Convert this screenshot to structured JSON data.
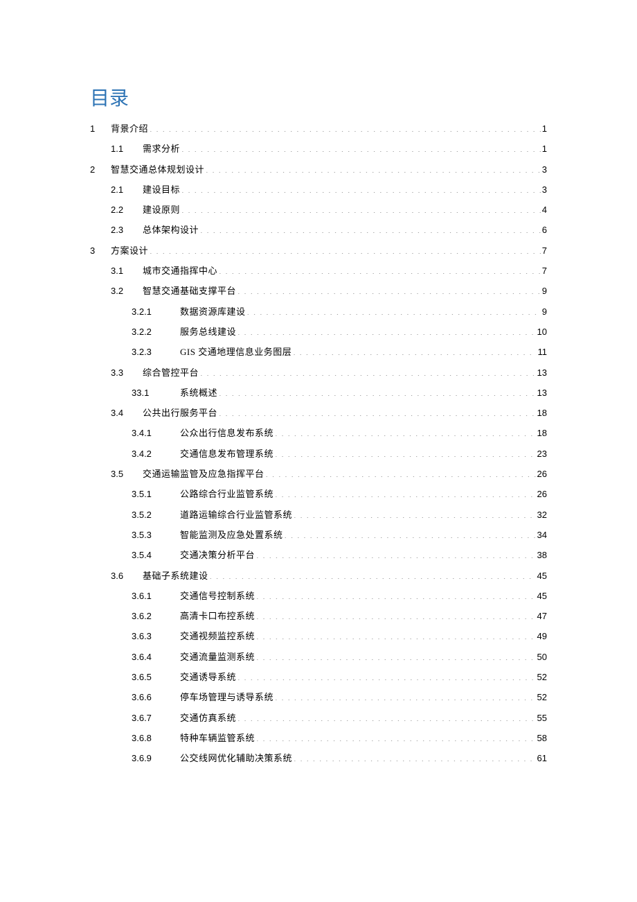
{
  "title": "目录",
  "toc": [
    {
      "level": 1,
      "num": "1",
      "label": "背景介绍",
      "page": "1"
    },
    {
      "level": 2,
      "num": "1.1",
      "label": "需求分析",
      "page": "1"
    },
    {
      "level": 1,
      "num": "2",
      "label": "智慧交通总体规划设计",
      "page": "3"
    },
    {
      "level": 2,
      "num": "2.1",
      "label": "建设目标",
      "page": "3"
    },
    {
      "level": 2,
      "num": "2.2",
      "label": "建设原则",
      "page": "4"
    },
    {
      "level": 2,
      "num": "2.3",
      "label": "总体架构设计",
      "page": "6"
    },
    {
      "level": 1,
      "num": "3",
      "label": "方案设计",
      "page": "7"
    },
    {
      "level": 2,
      "num": "3.1",
      "label": "城市交通指挥中心",
      "page": "7"
    },
    {
      "level": 2,
      "num": "3.2",
      "label": "智慧交通基础支撑平台",
      "page": "9"
    },
    {
      "level": 3,
      "num": "3.2.1",
      "label": "数据资源库建设",
      "page": "9"
    },
    {
      "level": 3,
      "num": "3.2.2",
      "label": "服务总线建设",
      "page": "10"
    },
    {
      "level": 3,
      "num": "3.2.3",
      "label": "GIS 交通地理信息业务图层",
      "page": "11"
    },
    {
      "level": 2,
      "num": "3.3",
      "label": "综合管控平台",
      "page": "13"
    },
    {
      "level": 3,
      "num": "33.1",
      "label": "系统概述",
      "page": "13"
    },
    {
      "level": 2,
      "num": "3.4",
      "label": "公共出行服务平台",
      "page": "18"
    },
    {
      "level": 3,
      "num": "3.4.1",
      "label": "公众出行信息发布系统",
      "page": "18"
    },
    {
      "level": 3,
      "num": "3.4.2",
      "label": "交通信息发布管理系统",
      "page": "23"
    },
    {
      "level": 2,
      "num": "3.5",
      "label": "交通运输监管及应急指挥平台",
      "page": "26"
    },
    {
      "level": 3,
      "num": "3.5.1",
      "label": "公路综合行业监管系统",
      "page": "26"
    },
    {
      "level": 3,
      "num": "3.5.2",
      "label": "道路运输综合行业监管系统",
      "page": "32"
    },
    {
      "level": 3,
      "num": "3.5.3",
      "label": "智能监测及应急处置系统",
      "page": "34"
    },
    {
      "level": 3,
      "num": "3.5.4",
      "label": "交通决策分析平台",
      "page": "38"
    },
    {
      "level": 2,
      "num": "3.6",
      "label": "基础子系统建设",
      "page": "45"
    },
    {
      "level": 3,
      "num": "3.6.1",
      "label": "交通信号控制系统",
      "page": "45"
    },
    {
      "level": 3,
      "num": "3.6.2",
      "label": "高清卡口布控系统",
      "page": "47"
    },
    {
      "level": 3,
      "num": "3.6.3",
      "label": "交通视频监控系统",
      "page": "49"
    },
    {
      "level": 3,
      "num": "3.6.4",
      "label": "交通流量监测系统",
      "page": "50"
    },
    {
      "level": 3,
      "num": "3.6.5",
      "label": "交通诱导系统",
      "page": "52"
    },
    {
      "level": 3,
      "num": "3.6.6",
      "label": "停车场管理与诱导系统",
      "page": "52"
    },
    {
      "level": 3,
      "num": "3.6.7",
      "label": "交通仿真系统",
      "page": "55"
    },
    {
      "level": 3,
      "num": "3.6.8",
      "label": "特种车辆监管系统",
      "page": "58"
    },
    {
      "level": 3,
      "num": "3.6.9",
      "label": "公交线网优化辅助决策系统",
      "page": "61"
    }
  ]
}
